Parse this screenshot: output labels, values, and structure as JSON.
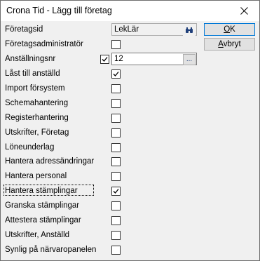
{
  "window": {
    "title": "Crona Tid - Lägg till företag",
    "close_icon": "close-icon"
  },
  "buttons": {
    "ok_label": "OK",
    "ok_mnemonic": "O",
    "cancel_label": "Avbryt",
    "cancel_mnemonic": "A"
  },
  "fields": {
    "foretagsid": {
      "label": "Företagsid",
      "value": "LekLär",
      "button_icon": "binoculars-icon"
    },
    "foretagsadministrator": {
      "label": "Företagsadministratör",
      "checked": false
    },
    "anstallningsnr": {
      "label": "Anställningsnr",
      "value": "12",
      "checked": true,
      "button_icon": "ellipsis-icon",
      "button_text": "..."
    }
  },
  "rows": [
    {
      "label": "Låst till anställd",
      "checked": true
    },
    {
      "label": "Import försystem",
      "checked": false
    },
    {
      "label": "Schemahantering",
      "checked": false
    },
    {
      "label": "Registerhantering",
      "checked": false
    },
    {
      "label": "Utskrifter, Företag",
      "checked": false
    },
    {
      "label": "Löneunderlag",
      "checked": false
    },
    {
      "label": "Hantera adressändringar",
      "checked": false
    },
    {
      "label": "Hantera personal",
      "checked": false
    },
    {
      "label": "Hantera stämplingar",
      "checked": true
    },
    {
      "label": "Granska stämplingar",
      "checked": false
    },
    {
      "label": "Attestera stämplingar",
      "checked": false
    },
    {
      "label": "Utskrifter, Anställd",
      "checked": false
    },
    {
      "label": "Synlig på närvaropanelen",
      "checked": false
    }
  ],
  "focused_row": "Hantera stämplingar"
}
